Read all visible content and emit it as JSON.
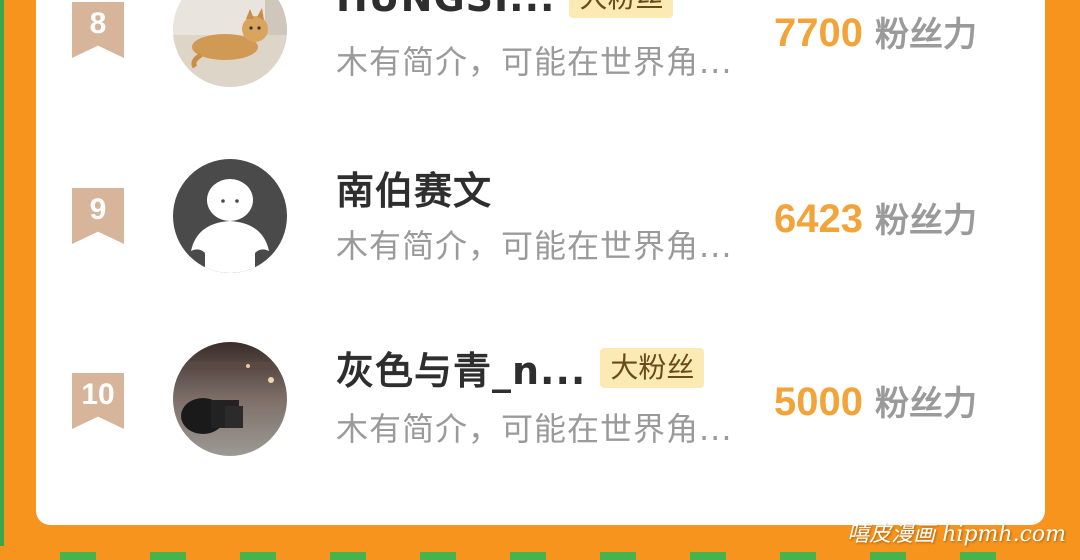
{
  "rows": [
    {
      "rank": "8",
      "name": "HUNGSI...",
      "tag": "大粉丝",
      "intro": "木有简介，可能在世界角...",
      "score": "7700",
      "score_label": "粉丝力",
      "avatar": "cat-photo"
    },
    {
      "rank": "9",
      "name": "南伯赛文",
      "tag": "",
      "intro": "木有简介，可能在世界角...",
      "score": "6423",
      "score_label": "粉丝力",
      "avatar": "default-person"
    },
    {
      "rank": "10",
      "name": "灰色与青_n...",
      "tag": "大粉丝",
      "intro": "木有简介，可能在世界角...",
      "score": "5000",
      "score_label": "粉丝力",
      "avatar": "night-street-photo"
    }
  ],
  "watermark": "嘻皮漫画 hipmh.com",
  "colors": {
    "background": "#f7941d",
    "score": "#f2a43a",
    "tag_bg": "#fbeab4",
    "badge": "#d7b59a",
    "edge": "#3aa84a"
  }
}
